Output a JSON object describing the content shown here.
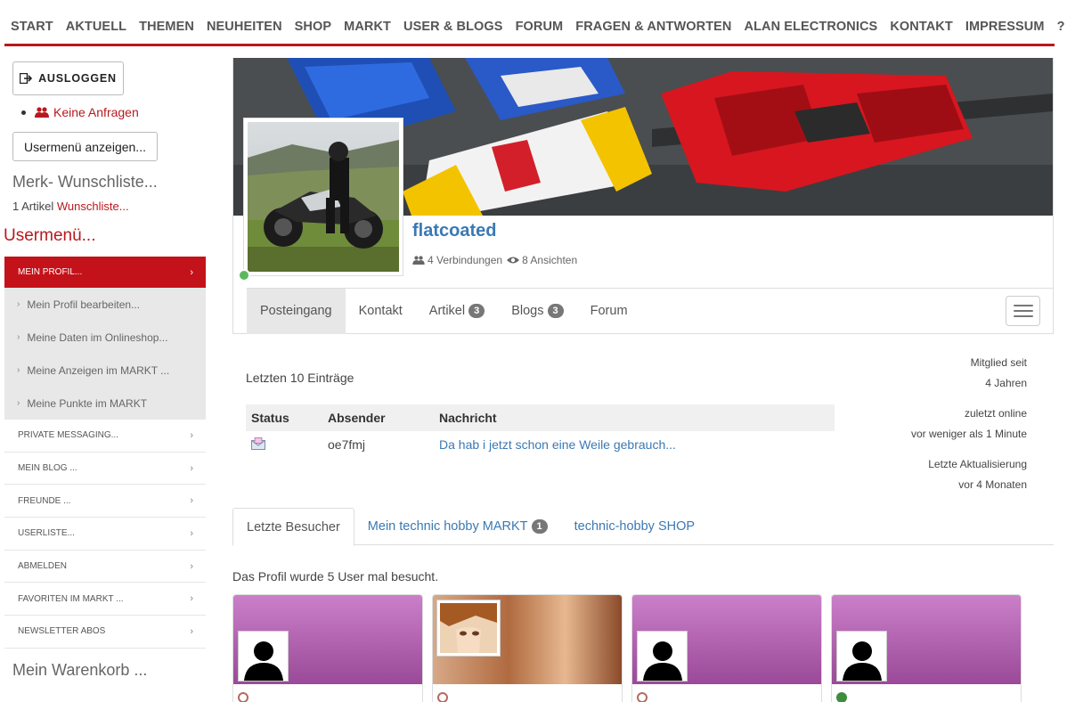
{
  "nav": {
    "items": [
      "START",
      "AKTUELL",
      "THEMEN",
      "NEUHEITEN",
      "SHOP",
      "MARKT",
      "USER & BLOGS",
      "FORUM",
      "FRAGEN & ANTWORTEN",
      "ALAN ELECTRONICS",
      "KONTAKT",
      "IMPRESSUM",
      "?"
    ]
  },
  "sidebar": {
    "logout_label": "AUSLOGGEN",
    "requests_label": "Keine Anfragen",
    "usermenu_button": "Usermenü anzeigen...",
    "wishlist_title": "Merk- Wunschliste...",
    "wishlist_count": "1 Artikel",
    "wishlist_link": "Wunschliste...",
    "usermenu_title": "Usermenü...",
    "menu": {
      "active": "MEIN PROFIL...",
      "sub": [
        "Mein Profil bearbeiten...",
        "Meine Daten im Onlineshop...",
        "Meine Anzeigen im MARKT ...",
        "Meine Punkte im MARKT"
      ],
      "items": [
        "PRIVATE MESSAGING...",
        "MEIN BLOG ...",
        "FREUNDE ...",
        "USERLISTE...",
        "ABMELDEN",
        "FAVORITEN IM MARKT ...",
        "NEWSLETTER ABOS"
      ]
    },
    "cart_title": "Mein Warenkorb ..."
  },
  "profile": {
    "username": "flatcoated",
    "connections": "4 Verbindungen",
    "views": "8 Ansichten",
    "tabs": [
      {
        "label": "Posteingang",
        "badge": ""
      },
      {
        "label": "Kontakt",
        "badge": ""
      },
      {
        "label": "Artikel",
        "badge": "3"
      },
      {
        "label": "Blogs",
        "badge": "3"
      },
      {
        "label": "Forum",
        "badge": ""
      }
    ]
  },
  "inbox": {
    "heading": "Letzten 10 Einträge",
    "columns": [
      "Status",
      "Absender",
      "Nachricht"
    ],
    "rows": [
      {
        "sender": "oe7fmj",
        "message": "Da hab i jetzt schon eine Weile gebrauch..."
      }
    ]
  },
  "stats": {
    "member_since_label": "Mitglied seit",
    "member_since_value": "4 Jahren",
    "last_online_label": "zuletzt online",
    "last_online_value": "vor weniger als 1 Minute",
    "last_update_label": "Letzte Aktualisierung",
    "last_update_value": "vor 4 Monaten"
  },
  "lower_tabs": {
    "visitors": "Letzte Besucher",
    "market": "Mein technic hobby MARKT",
    "market_badge": "1",
    "shop": "technic-hobby SHOP"
  },
  "visits_text": "Das Profil wurde 5 User mal besucht.",
  "colors": {
    "brand_red": "#b8191e",
    "link_blue": "#3a79b4",
    "online_green": "#5cb85c"
  }
}
